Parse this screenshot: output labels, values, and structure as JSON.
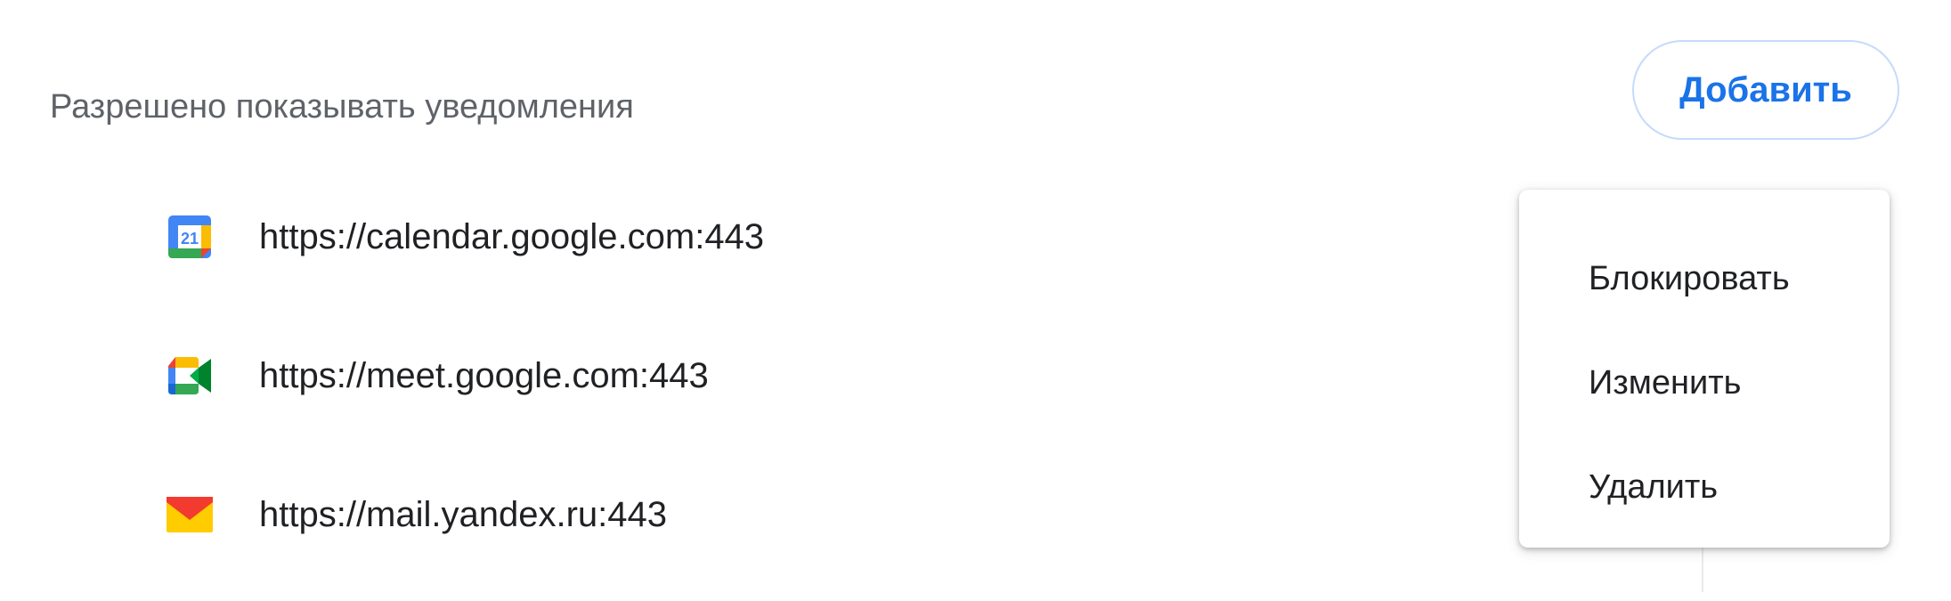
{
  "section": {
    "title": "Разрешено показывать уведомления",
    "add_label": "Добавить"
  },
  "sites": [
    {
      "url": "https://calendar.google.com:443",
      "icon": "google-calendar-icon"
    },
    {
      "url": "https://meet.google.com:443",
      "icon": "google-meet-icon"
    },
    {
      "url": "https://mail.yandex.ru:443",
      "icon": "yandex-mail-icon"
    }
  ],
  "menu": {
    "items": [
      {
        "label": "Блокировать"
      },
      {
        "label": "Изменить"
      },
      {
        "label": "Удалить"
      }
    ]
  },
  "colors": {
    "accent": "#1a73e8",
    "title_gray": "#5f6368",
    "text": "#202124",
    "button_border": "#c6dafc"
  }
}
